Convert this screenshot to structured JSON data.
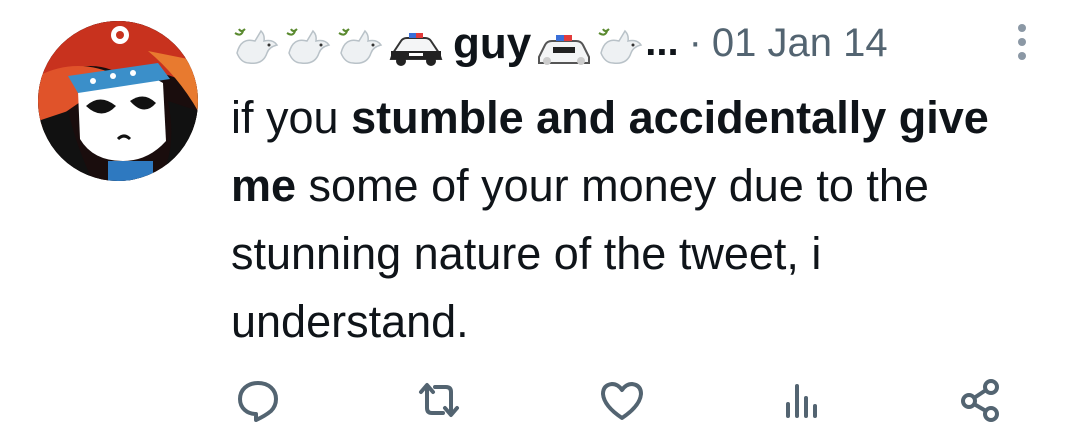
{
  "tweet": {
    "author": {
      "display_name": "guy",
      "truncation": "...",
      "separator": "·",
      "date": "01 Jan 14",
      "name_emojis": [
        "dove-icon",
        "dove-icon",
        "dove-icon",
        "police-car-icon",
        "police-car-icon",
        "dove-icon"
      ]
    },
    "text": {
      "p1": "if you ",
      "b1": "stumble and accidentally give me",
      "p2": " some of your money due to the stunning nature of the tweet, i understand."
    },
    "actions": [
      "reply-icon",
      "retweet-icon",
      "like-icon",
      "views-icon",
      "share-icon"
    ],
    "colors": {
      "text": "#0f1419",
      "secondary": "#536471",
      "icon": "#536471"
    }
  }
}
